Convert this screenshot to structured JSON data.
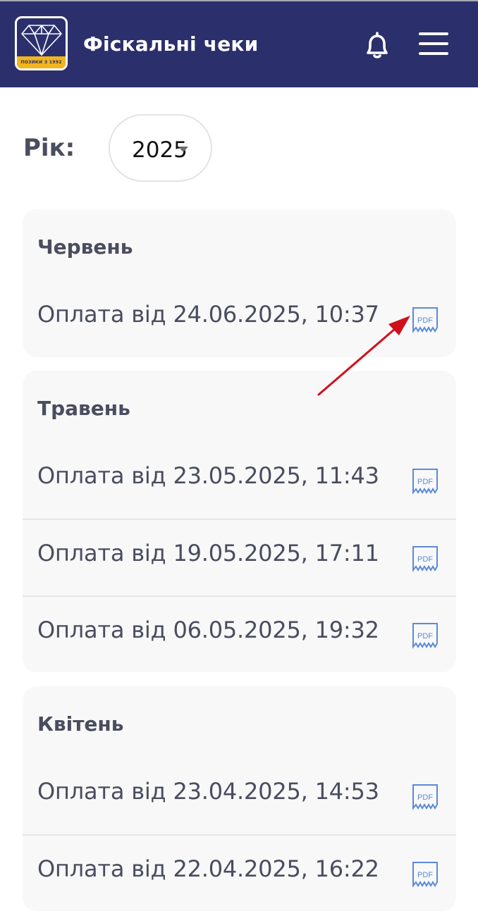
{
  "header": {
    "logo_tagline": "ПОЗИКИ З 1992",
    "title": "Фіскальні чеки",
    "bell_icon": "bell-icon",
    "menu_icon": "hamburger-menu-icon"
  },
  "filter": {
    "label": "Рік:",
    "year": "2025"
  },
  "months": [
    {
      "title": "Червень",
      "receipts": [
        {
          "label": "Оплата від 24.06.2025, 10:37",
          "icon": "pdf-icon"
        }
      ]
    },
    {
      "title": "Травень",
      "receipts": [
        {
          "label": "Оплата від 23.05.2025, 11:43",
          "icon": "pdf-icon"
        },
        {
          "label": "Оплата від 19.05.2025, 17:11",
          "icon": "pdf-icon"
        },
        {
          "label": "Оплата від 06.05.2025, 19:32",
          "icon": "pdf-icon"
        }
      ]
    },
    {
      "title": "Квітень",
      "receipts": [
        {
          "label": "Оплата від 23.04.2025, 14:53",
          "icon": "pdf-icon"
        },
        {
          "label": "Оплата від 22.04.2025, 16:22",
          "icon": "pdf-icon"
        }
      ]
    }
  ],
  "pdf_icon_text": "PDF",
  "colors": {
    "header_bg": "#2b306c",
    "brand_yellow": "#f2b51c",
    "text": "#4a4d5e",
    "card_bg": "#f8f8f9",
    "pdf_icon": "#5b8ad6",
    "annotation_arrow": "#d0101a"
  }
}
